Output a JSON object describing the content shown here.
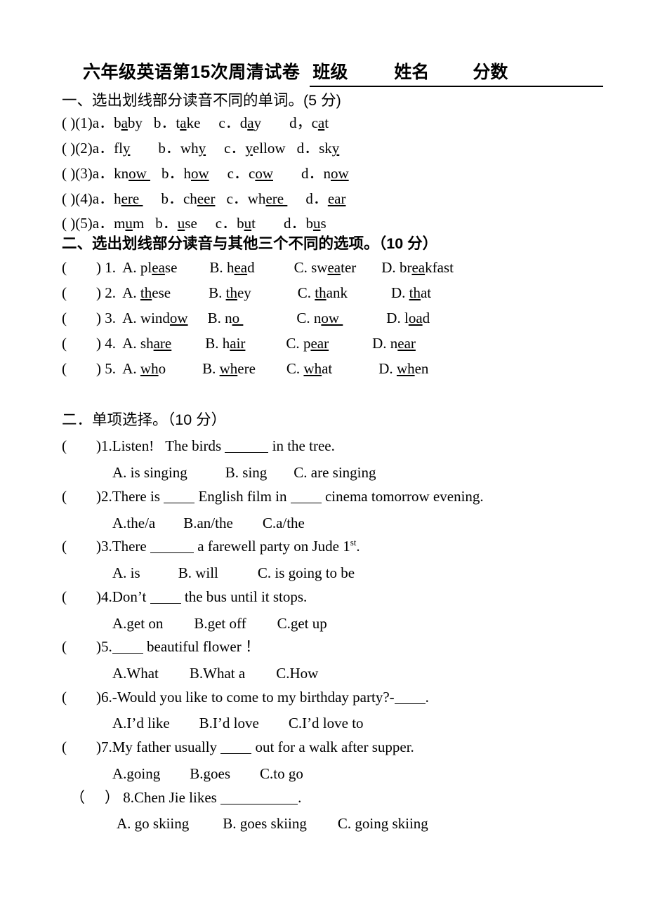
{
  "document": {
    "title_main": "六年级英语第15次周清试卷",
    "fields": [
      "班级",
      "姓名",
      "分数"
    ]
  },
  "section1": {
    "heading": "一、选出划线部分读音不同的单词。(5 分)",
    "items": [
      {
        "marker": "(  )",
        "number": "(1)",
        "options": [
          {
            "label": "a．",
            "pre": "b",
            "mark": "a",
            "post": "by"
          },
          {
            "label": "b．",
            "pre": "t",
            "mark": "a",
            "post": "ke"
          },
          {
            "label": "c．",
            "pre": "d",
            "mark": "a",
            "post": "y"
          },
          {
            "label": "d，",
            "pre": "c",
            "mark": "a",
            "post": "t"
          }
        ]
      },
      {
        "marker": "(  )",
        "number": "(2)",
        "options": [
          {
            "label": "a．",
            "pre": "fl",
            "mark": "y",
            "post": ""
          },
          {
            "label": "b．",
            "pre": "wh",
            "mark": "y",
            "post": ""
          },
          {
            "label": "c．",
            "pre": "",
            "mark": "y",
            "post": "ellow"
          },
          {
            "label": "d．",
            "pre": "sk",
            "mark": "y",
            "post": ""
          }
        ]
      },
      {
        "marker": "(  )",
        "number": "(3)",
        "options": [
          {
            "label": "a．",
            "pre": "kn",
            "mark": "ow ",
            "post": ""
          },
          {
            "label": "b．",
            "pre": "h",
            "mark": "ow",
            "post": ""
          },
          {
            "label": "c．",
            "pre": "c",
            "mark": "ow",
            "post": ""
          },
          {
            "label": "d．",
            "pre": "n",
            "mark": "ow",
            "post": ""
          }
        ]
      },
      {
        "marker": "(  )",
        "number": "(4)",
        "options": [
          {
            "label": "a．",
            "pre": "h",
            "mark": "ere ",
            "post": ""
          },
          {
            "label": "b．",
            "pre": "ch",
            "mark": "eer",
            "post": ""
          },
          {
            "label": "c．",
            "pre": "wh",
            "mark": "ere ",
            "post": ""
          },
          {
            "label": "d．",
            "pre": "",
            "mark": "ear",
            "post": ""
          }
        ]
      },
      {
        "marker": "(  )",
        "number": "(5)",
        "options": [
          {
            "label": "a．",
            "pre": "m",
            "mark": "u",
            "post": "m"
          },
          {
            "label": "b．",
            "pre": "",
            "mark": "u",
            "post": "se"
          },
          {
            "label": "c．",
            "pre": "b",
            "mark": "u",
            "post": "t"
          },
          {
            "label": "d．",
            "pre": "b",
            "mark": "u",
            "post": "s"
          }
        ]
      }
    ]
  },
  "section2": {
    "heading": "二、选出划线部分读音与其他三个不同的选项。（10 分）",
    "items": [
      {
        "marker": "(",
        "close": ")",
        "number": "1.",
        "options": [
          {
            "label": "A. ",
            "pre": "pl",
            "mark": "ea",
            "post": "se"
          },
          {
            "label": "B. ",
            "pre": "h",
            "mark": "ea",
            "post": "d"
          },
          {
            "label": "C. ",
            "pre": "sw",
            "mark": "ea",
            "post": "ter"
          },
          {
            "label": "D. ",
            "pre": "br",
            "mark": "ea",
            "post": "kfast"
          }
        ]
      },
      {
        "marker": "(",
        "close": ")",
        "number": "2.",
        "options": [
          {
            "label": "A. ",
            "pre": "",
            "mark": "th",
            "post": "ese"
          },
          {
            "label": "B. ",
            "pre": "",
            "mark": "th",
            "post": "ey"
          },
          {
            "label": "C. ",
            "pre": "",
            "mark": "th",
            "post": "ank"
          },
          {
            "label": "D. ",
            "pre": "",
            "mark": "th",
            "post": "at"
          }
        ]
      },
      {
        "marker": "(",
        "close": ")",
        "number": "3.",
        "options": [
          {
            "label": "A. ",
            "pre": "wind",
            "mark": "ow",
            "post": ""
          },
          {
            "label": "B. ",
            "pre": "n",
            "mark": "o ",
            "post": ""
          },
          {
            "label": "C. ",
            "pre": "n",
            "mark": "ow ",
            "post": ""
          },
          {
            "label": "D. ",
            "pre": "l",
            "mark": "oa",
            "post": "d"
          }
        ]
      },
      {
        "marker": "(",
        "close": ")",
        "number": "4.",
        "options": [
          {
            "label": "A. ",
            "pre": "sh",
            "mark": "are",
            "post": ""
          },
          {
            "label": "B. ",
            "pre": "h",
            "mark": "air",
            "post": ""
          },
          {
            "label": "C. ",
            "pre": "p",
            "mark": "ear",
            "post": ""
          },
          {
            "label": "D. ",
            "pre": "n",
            "mark": "ear",
            "post": ""
          }
        ]
      },
      {
        "marker": "(",
        "close": ")",
        "number": "5.",
        "options": [
          {
            "label": "A. ",
            "pre": "",
            "mark": "wh",
            "post": "o"
          },
          {
            "label": "B. ",
            "pre": "",
            "mark": "wh",
            "post": "ere"
          },
          {
            "label": "C. ",
            "pre": "",
            "mark": "wh",
            "post": "at"
          },
          {
            "label": "D. ",
            "pre": "",
            "mark": "wh",
            "post": "en"
          }
        ]
      }
    ]
  },
  "section3": {
    "heading": "二．单项选择。（10 分）",
    "questions": [
      {
        "marker": "(",
        "close": ")",
        "number": "1.",
        "stem_a": "Listen!",
        "stem_b": "The birds ",
        "stem_c": " in the tree.",
        "choices": [
          "A. is singing",
          "B.   sing",
          "C. are singing"
        ]
      },
      {
        "marker": "(",
        "close": ")",
        "number": "2.",
        "stem_a": "There is ",
        "stem_b": " English film in ",
        "stem_c": " cinema tomorrow evening.",
        "choices": [
          "A.the/a",
          "B.an/the",
          "C.a/the"
        ]
      },
      {
        "marker": "(",
        "close": ")",
        "number": "3.",
        "stem_a": "There ",
        "stem_b": " a farewell party on Jude 1",
        "sup": "st",
        "stem_c": ".",
        "choices": [
          "A. is",
          "B. will",
          "C. is going to be"
        ]
      },
      {
        "marker": "(",
        "close": ")",
        "number": "4.",
        "stem_a": "Don’t ",
        "stem_b": " the bus until it stops.",
        "choices": [
          "A.get on",
          "B.get off",
          "C.get up"
        ]
      },
      {
        "marker": "(",
        "close": ")",
        "number": "5.",
        "stem_a": "",
        "stem_b": " beautiful flower  ！",
        "choices": [
          "A.What",
          "B.What a",
          "C.How"
        ]
      },
      {
        "marker": "(",
        "close": ")",
        "number": "6.",
        "stem_a": "-Would you like to come to my birthday party?-",
        "stem_b": ".",
        "choices": [
          "A.I’d like",
          "B.I’d love",
          "C.I’d love to"
        ]
      },
      {
        "marker": "(",
        "close": ")",
        "number": "7.",
        "stem_a": "My father usually ",
        "stem_b": " out for a walk after supper.",
        "choices": [
          "A.going",
          "B.goes",
          "C.to go"
        ]
      },
      {
        "marker": "（",
        "close": "）",
        "number": " 8.",
        "stem_a": "Chen Jie likes ",
        "stem_b": ".",
        "choices": [
          "A. go skiing",
          "B. goes skiing",
          "C. going skiing"
        ]
      }
    ]
  }
}
